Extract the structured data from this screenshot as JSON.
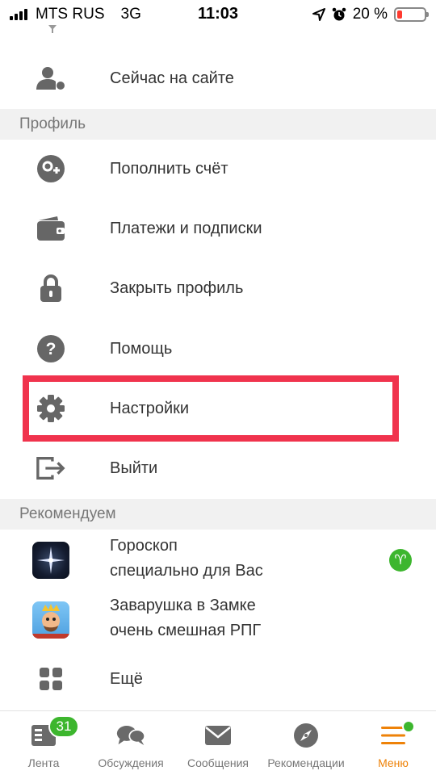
{
  "status_bar": {
    "carrier": "MTS RUS",
    "network": "3G",
    "time": "11:03",
    "battery_percent": "20 %",
    "battery_level": 0.2
  },
  "menu": {
    "online": "Сейчас на сайте",
    "section_profile": "Профиль",
    "profile_items": [
      {
        "label": "Пополнить счёт",
        "icon": "coin-plus-icon"
      },
      {
        "label": "Платежи и подписки",
        "icon": "wallet-icon"
      },
      {
        "label": "Закрыть профиль",
        "icon": "lock-icon"
      },
      {
        "label": "Помощь",
        "icon": "help-icon"
      },
      {
        "label": "Настройки",
        "icon": "gear-icon"
      },
      {
        "label": "Выйти",
        "icon": "logout-icon"
      }
    ],
    "section_recommend": "Рекомендуем",
    "apps": [
      {
        "title": "Гороскоп",
        "subtitle": "специально для Вас",
        "badge": "♈"
      },
      {
        "title": "Заварушка в Замке",
        "subtitle": "очень смешная РПГ"
      }
    ],
    "more": "Ещё"
  },
  "tabbar": {
    "tabs": [
      {
        "label": "Лента",
        "badge": "31"
      },
      {
        "label": "Обсуждения"
      },
      {
        "label": "Сообщения"
      },
      {
        "label": "Рекомендации"
      },
      {
        "label": "Меню"
      }
    ]
  },
  "colors": {
    "accent": "#ee8208",
    "highlight": "#f0334d",
    "badge": "#3db62e",
    "icon": "#666666"
  }
}
